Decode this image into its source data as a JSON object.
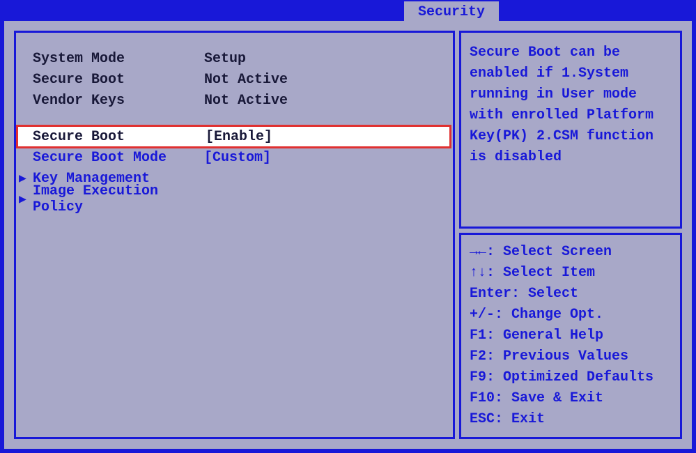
{
  "tab": {
    "label": "Security"
  },
  "status": [
    {
      "label": "System Mode",
      "value": "Setup"
    },
    {
      "label": "Secure Boot",
      "value": "Not Active"
    },
    {
      "label": "Vendor Keys",
      "value": "Not Active"
    }
  ],
  "options": {
    "secure_boot": {
      "label": "Secure Boot",
      "value": "[Enable]"
    },
    "secure_boot_mode": {
      "label": "Secure Boot Mode",
      "value": "[Custom]"
    },
    "key_management": {
      "label": "Key Management"
    },
    "image_exec_policy": {
      "label": "Image Execution Policy"
    }
  },
  "help": {
    "text": "Secure Boot can be enabled if 1.System running in User mode with enrolled Platform Key(PK) 2.CSM function is disabled"
  },
  "nav": [
    "→←: Select Screen",
    "↑↓: Select Item",
    "Enter: Select",
    "+/-: Change Opt.",
    "F1: General Help",
    "F2: Previous Values",
    "F9: Optimized Defaults",
    "F10: Save & Exit",
    "ESC: Exit"
  ]
}
